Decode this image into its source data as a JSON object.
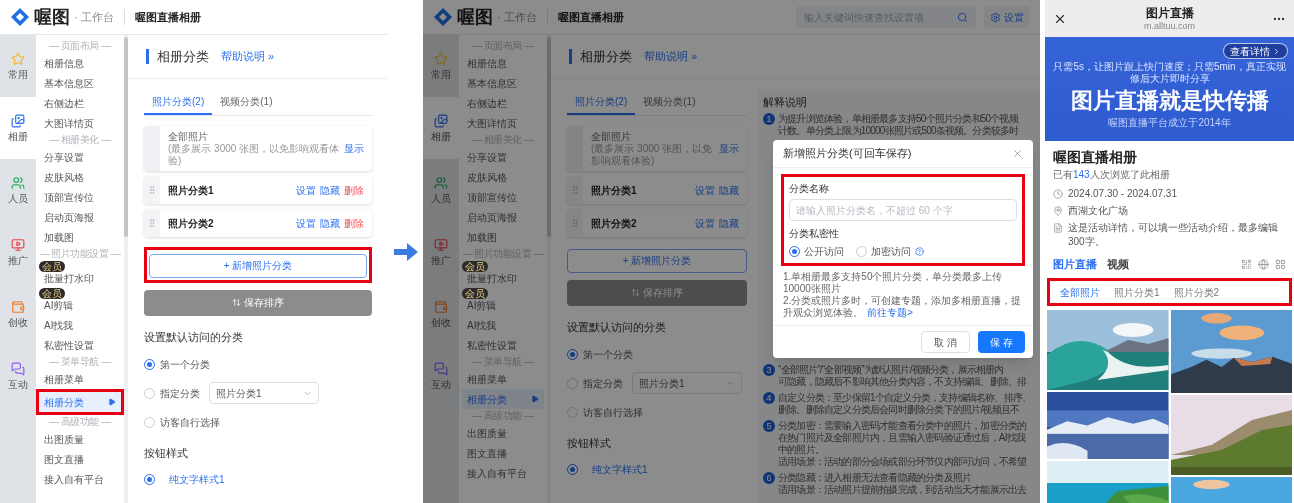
{
  "left_screen": {
    "header": {
      "logo": "喔图",
      "workspace": "· 工作台",
      "album_name": "喔图直播相册"
    },
    "rail": [
      {
        "label": "常用",
        "selected": false
      },
      {
        "label": "相册",
        "selected": true
      },
      {
        "label": "人员",
        "selected": false
      },
      {
        "label": "推广",
        "selected": false
      },
      {
        "label": "创收",
        "selected": false
      },
      {
        "label": "互动",
        "selected": false
      }
    ],
    "menu": [
      {
        "kind": "heading",
        "label": "— 页面布局 —"
      },
      {
        "kind": "item",
        "label": "相册信息",
        "selected": false,
        "highlighted": false
      },
      {
        "kind": "item",
        "label": "基本信息区",
        "selected": false,
        "highlighted": false
      },
      {
        "kind": "item",
        "label": "右侧边栏",
        "selected": false,
        "highlighted": false
      },
      {
        "kind": "item",
        "label": "大图详情页",
        "selected": false,
        "highlighted": false
      },
      {
        "kind": "heading",
        "label": "— 相册美化 —"
      },
      {
        "kind": "item",
        "label": "分享设置",
        "selected": false,
        "highlighted": false
      },
      {
        "kind": "item",
        "label": "皮肤风格",
        "selected": false,
        "highlighted": false
      },
      {
        "kind": "item",
        "label": "顶部宣传位",
        "selected": false,
        "highlighted": false
      },
      {
        "kind": "item",
        "label": "启动页海报",
        "selected": false,
        "highlighted": false
      },
      {
        "kind": "item",
        "label": "加载图",
        "selected": false,
        "highlighted": false
      },
      {
        "kind": "heading",
        "label": "— 照片功能设置 —"
      },
      {
        "kind": "item",
        "label": "批量打水印",
        "selected": false,
        "highlighted": false,
        "badge": "会员"
      },
      {
        "kind": "item",
        "label": "AI剪辑",
        "selected": false,
        "highlighted": false,
        "badge": "会员"
      },
      {
        "kind": "item",
        "label": "AI找我",
        "selected": false,
        "highlighted": false
      },
      {
        "kind": "item",
        "label": "私密性设置",
        "selected": false,
        "highlighted": false
      },
      {
        "kind": "heading",
        "label": "— 菜单导航 —"
      },
      {
        "kind": "item",
        "label": "相册菜单",
        "selected": false,
        "highlighted": false
      },
      {
        "kind": "item",
        "label": "相册分类",
        "selected": true,
        "highlighted": true
      },
      {
        "kind": "heading",
        "label": "— 高级功能 —"
      },
      {
        "kind": "item",
        "label": "出图质量",
        "selected": false,
        "highlighted": false
      },
      {
        "kind": "item",
        "label": "图文直播",
        "selected": false,
        "highlighted": false
      },
      {
        "kind": "item",
        "label": "接入自有平台",
        "selected": false,
        "highlighted": false
      }
    ],
    "page_title": "相册分类",
    "help_link": "帮助说明 »",
    "tabs": [
      {
        "label": "照片分类(2)",
        "selected": true
      },
      {
        "label": "视频分类(1)",
        "selected": false
      }
    ],
    "categories": [
      {
        "kind": "default",
        "name": "全部照片",
        "note": "(最多展示 3000 张图，以免影响观看体验)",
        "actions": [
          {
            "label": "显示",
            "kind": "link"
          }
        ]
      },
      {
        "kind": "custom",
        "name": "照片分类1",
        "actions": [
          {
            "label": "设置",
            "kind": "link"
          },
          {
            "label": "隐藏",
            "kind": "link"
          },
          {
            "label": "删除",
            "kind": "danger"
          }
        ]
      },
      {
        "kind": "custom",
        "name": "照片分类2",
        "actions": [
          {
            "label": "设置",
            "kind": "link"
          },
          {
            "label": "隐藏",
            "kind": "link"
          },
          {
            "label": "删除",
            "kind": "danger"
          }
        ]
      }
    ],
    "add_button": {
      "label": "+ 新增照片分类",
      "highlighted": true
    },
    "sort_button": "保存排序",
    "default_section": {
      "title": "设置默认访问的分类",
      "options": [
        {
          "label": "第一个分类",
          "selected": true
        },
        {
          "label": "指定分类",
          "selected": false,
          "select_value": "照片分类1"
        },
        {
          "label": "访客自行选择",
          "selected": false
        }
      ]
    },
    "button_style": {
      "title": "按钮样式",
      "options": [
        {
          "label": "纯文字样式1",
          "selected": true
        }
      ]
    }
  },
  "middle_screen": {
    "header": {
      "logo": "喔图",
      "workspace": "· 工作台",
      "album_name": "喔图直播相册"
    },
    "search": {
      "placeholder": "输入关键词快速查找设置项"
    },
    "settings_button": "设置",
    "rail": [
      {
        "label": "常用",
        "selected": false
      },
      {
        "label": "相册",
        "selected": true
      },
      {
        "label": "人员",
        "selected": false
      },
      {
        "label": "推广",
        "selected": false
      },
      {
        "label": "创收",
        "selected": false
      },
      {
        "label": "互动",
        "selected": false
      }
    ],
    "menu": [
      {
        "kind": "heading",
        "label": "— 页面布局 —"
      },
      {
        "kind": "item",
        "label": "相册信息",
        "selected": false,
        "highlighted": false
      },
      {
        "kind": "item",
        "label": "基本信息区",
        "selected": false,
        "highlighted": false
      },
      {
        "kind": "item",
        "label": "右侧边栏",
        "selected": false,
        "highlighted": false
      },
      {
        "kind": "item",
        "label": "大图详情页",
        "selected": false,
        "highlighted": false
      },
      {
        "kind": "heading",
        "label": "— 相册美化 —"
      },
      {
        "kind": "item",
        "label": "分享设置",
        "selected": false,
        "highlighted": false
      },
      {
        "kind": "item",
        "label": "皮肤风格",
        "selected": false,
        "highlighted": false
      },
      {
        "kind": "item",
        "label": "顶部宣传位",
        "selected": false,
        "highlighted": false
      },
      {
        "kind": "item",
        "label": "启动页海报",
        "selected": false,
        "highlighted": false
      },
      {
        "kind": "item",
        "label": "加载图",
        "selected": false,
        "highlighted": false
      },
      {
        "kind": "heading",
        "label": "— 照片功能设置 —"
      },
      {
        "kind": "item",
        "label": "批量打水印",
        "selected": false,
        "highlighted": false,
        "badge": "会员"
      },
      {
        "kind": "item",
        "label": "AI剪辑",
        "selected": false,
        "highlighted": false,
        "badge": "会员"
      },
      {
        "kind": "item",
        "label": "AI找我",
        "selected": false,
        "highlighted": false
      },
      {
        "kind": "item",
        "label": "私密性设置",
        "selected": false,
        "highlighted": false
      },
      {
        "kind": "heading",
        "label": "— 菜单导航 —"
      },
      {
        "kind": "item",
        "label": "相册菜单",
        "selected": false,
        "highlighted": false
      },
      {
        "kind": "item",
        "label": "相册分类",
        "selected": true,
        "highlighted": false
      },
      {
        "kind": "heading",
        "label": "— 高级功能 —"
      },
      {
        "kind": "item",
        "label": "出图质量",
        "selected": false,
        "highlighted": false
      },
      {
        "kind": "item",
        "label": "图文直播",
        "selected": false,
        "highlighted": false
      },
      {
        "kind": "item",
        "label": "接入自有平台",
        "selected": false,
        "highlighted": false
      }
    ],
    "page_title": "相册分类",
    "help_link": "帮助说明 »",
    "tabs": [
      {
        "label": "照片分类(2)",
        "selected": true
      },
      {
        "label": "视频分类(1)",
        "selected": false
      }
    ],
    "categories": [
      {
        "kind": "default",
        "name": "全部照片",
        "note": "(最多展示 3000 张图，以免影响观看体验)",
        "actions": [
          {
            "label": "显示",
            "kind": "link"
          }
        ]
      },
      {
        "kind": "custom",
        "name": "照片分类1",
        "actions": [
          {
            "label": "设置",
            "kind": "link"
          },
          {
            "label": "隐藏",
            "kind": "link"
          }
        ]
      },
      {
        "kind": "custom",
        "name": "照片分类2",
        "actions": [
          {
            "label": "设置",
            "kind": "link"
          },
          {
            "label": "隐藏",
            "kind": "link"
          }
        ]
      }
    ],
    "add_button": {
      "label": "+ 新增照片分类",
      "highlighted": false
    },
    "sort_button": "保存排序",
    "default_section": {
      "title": "设置默认访问的分类",
      "options": [
        {
          "label": "第一个分类",
          "selected": true
        },
        {
          "label": "指定分类",
          "selected": false,
          "select_value": "照片分类1"
        },
        {
          "label": "访客自行选择",
          "selected": false
        }
      ]
    },
    "button_style": {
      "title": "按钮样式",
      "options": [
        {
          "label": "纯文字样式1",
          "selected": true
        }
      ]
    },
    "explanation": {
      "title": "解释说明",
      "items": [
        {
          "number": "1",
          "lines": [
            "为提升浏览体验，单相册最多支持50个照片分类和50个视频",
            "计数。单分类上限为10000张照片或500条视频。分类较多时"
          ]
        },
        {
          "number": "3",
          "lines": [
            "“全部照片”/“全部视频”为默认照片/视频分类，展示相册内",
            "可隐藏，隐藏后不影响其他分类内容，不支持编辑、删除、排"
          ]
        },
        {
          "number": "4",
          "lines": [
            "自定义分类：至少保留1个自定义分类，支持编辑名称、排序、",
            "删除。删除自定义分类后会同时删除分类下的照片/视频且不"
          ]
        },
        {
          "number": "5",
          "lines": [
            "分类加密：需要输入密码才能查看分类中的照片，加密分类的",
            "在热门照片及全部照片内，且需输入密码验证通过后，AI找我",
            "中的照片。",
            "适用场景：活动的部分会场或部分环节仅内部可访问，不希望"
          ]
        },
        {
          "number": "6",
          "lines": [
            "分类隐藏：进入相册无法查看隐藏的分类及照片",
            "适用场景：活动照片提前拍摄完成，到活动当天才能展示出去"
          ]
        }
      ]
    },
    "dialog": {
      "title": "新增照片分类(可回车保存)",
      "highlighted": true,
      "name_label": "分类名称",
      "name_placeholder": "请输入照片分类名，不超过 60 个字",
      "privacy_label": "分类私密性",
      "privacy_options": [
        {
          "label": "公开访问",
          "selected": true,
          "help": false
        },
        {
          "label": "加密访问",
          "selected": false,
          "help": true
        }
      ],
      "notes": [
        "1.单相册最多支持50个照片分类，单分类最多上传10000张照片",
        "2.分类或照片多时，可创建专题，添加多相册直播，提升观众浏览体验。"
      ],
      "link": "前往专题>",
      "buttons": [
        {
          "label": "取 消",
          "kind": "secondary"
        },
        {
          "label": "保 存",
          "kind": "primary"
        }
      ]
    }
  },
  "phone": {
    "title": "图片直播",
    "domain": "m.alltuu.com",
    "banner": {
      "button": "查看详情",
      "tagline": "只需5s，让图片跟上快门速度；只需5min，真正实现修后大片即时分享",
      "headline": "图片直播就是快传播",
      "footer": "喔图直播平台成立于2014年"
    },
    "album_title": "喔图直播相册",
    "views": {
      "prefix": "已有",
      "count": "143",
      "suffix": "人次浏览了此相册"
    },
    "info": [
      {
        "kind": "date",
        "text": "2024.07.30 - 2024.07.31"
      },
      {
        "kind": "location",
        "text": "西湖文化广场"
      },
      {
        "kind": "description",
        "text": "这是活动详情，可以填一些活动介绍，最多编辑300字。"
      }
    ],
    "tabs": [
      {
        "label": "图片直播",
        "selected": true
      },
      {
        "label": "视频",
        "selected": false
      }
    ],
    "categories": {
      "highlighted": true,
      "items": [
        {
          "label": "全部照片",
          "selected": true
        },
        {
          "label": "照片分类1",
          "selected": false
        },
        {
          "label": "照片分类2",
          "selected": false
        }
      ]
    }
  }
}
